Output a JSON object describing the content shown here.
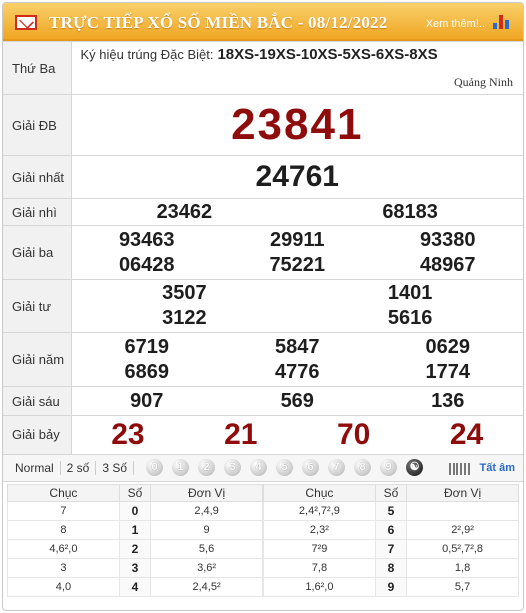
{
  "header": {
    "title": "TRỰC TIẾP XỔ SỐ MIỀN BẮC - 08/12/2022",
    "more_link": "Xem thêm!..",
    "mail_icon": "mail-icon",
    "stats_icon": "bar-chart-icon"
  },
  "day": "Thứ Ba",
  "special_symbol": {
    "label": "Ký hiệu trúng Đặc Biệt:",
    "value": "18XS-19XS-10XS-5XS-6XS-8XS",
    "province": "Quảng Ninh"
  },
  "prizes": {
    "db": {
      "label": "Giải ĐB",
      "numbers": [
        "23841"
      ]
    },
    "g1": {
      "label": "Giải nhất",
      "numbers": [
        "24761"
      ]
    },
    "g2": {
      "label": "Giải nhì",
      "numbers": [
        "23462",
        "68183"
      ]
    },
    "g3": {
      "label": "Giải ba",
      "numbers": [
        "93463",
        "29911",
        "93380",
        "06428",
        "75221",
        "48967"
      ]
    },
    "g4": {
      "label": "Giải tư",
      "numbers": [
        "3507",
        "1401",
        "3122",
        "5616"
      ]
    },
    "g5": {
      "label": "Giải năm",
      "numbers": [
        "6719",
        "5847",
        "0629",
        "6869",
        "4776",
        "1774"
      ]
    },
    "g6": {
      "label": "Giải sáu",
      "numbers": [
        "907",
        "569",
        "136"
      ]
    },
    "g7": {
      "label": "Giải bảy",
      "numbers": [
        "23",
        "21",
        "70",
        "24"
      ]
    }
  },
  "toolbar": {
    "options": [
      "Normal",
      "2 số",
      "3 Số"
    ],
    "balls": [
      "0",
      "1",
      "2",
      "3",
      "4",
      "5",
      "6",
      "7",
      "8",
      "9"
    ],
    "yinyang_icon": "yin-yang-icon",
    "zoom_icon": "barcode-zoom-icon",
    "all_label": "Tất âm"
  },
  "loto": {
    "headers": [
      "Chục",
      "Số",
      "Đơn Vị"
    ],
    "left": [
      {
        "chuc": "7",
        "so": "0",
        "donvi": "2,4,9"
      },
      {
        "chuc": "8",
        "so": "1",
        "donvi": "9"
      },
      {
        "chuc": "4,6²,0",
        "so": "2",
        "donvi": "5,6"
      },
      {
        "chuc": "3",
        "so": "3",
        "donvi": "3,6²"
      },
      {
        "chuc": "4,0",
        "so": "4",
        "donvi": "2,4,5²"
      }
    ],
    "right": [
      {
        "chuc": "2,4²,7²,9",
        "so": "5",
        "donvi": ""
      },
      {
        "chuc": "2,3²",
        "so": "6",
        "donvi": "2²,9²"
      },
      {
        "chuc": "7²9",
        "so": "7",
        "donvi": "0,5²,7²,8"
      },
      {
        "chuc": "7,8",
        "so": "8",
        "donvi": "1,8"
      },
      {
        "chuc": "1,6²,0",
        "so": "9",
        "donvi": "5,7"
      }
    ]
  }
}
